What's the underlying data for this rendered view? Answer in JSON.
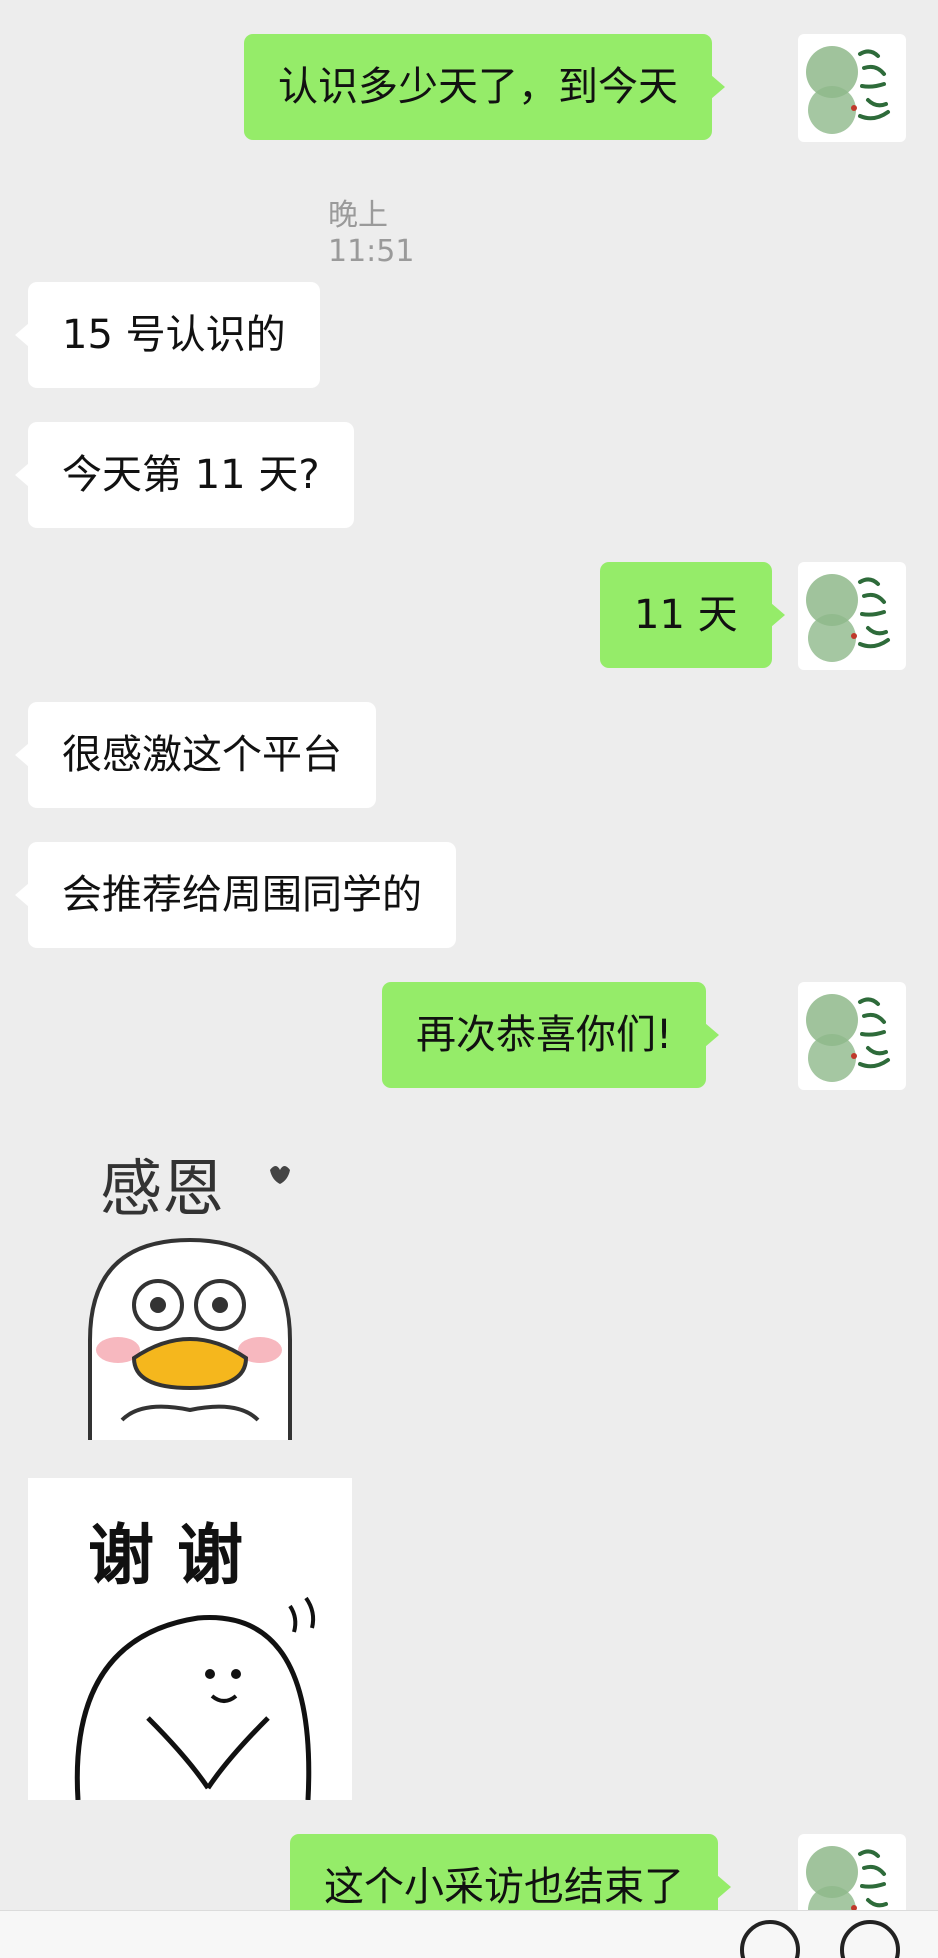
{
  "chat": {
    "timestamp": "晚上11:51",
    "messages": [
      {
        "id": 1,
        "side": "out",
        "text": "认识多少天了，到今天"
      },
      {
        "id": 2,
        "side": "in",
        "text": "15 号认识的"
      },
      {
        "id": 3,
        "side": "in",
        "text": "今天第 11 天?"
      },
      {
        "id": 4,
        "side": "out",
        "text": "11 天"
      },
      {
        "id": 5,
        "side": "in",
        "text": "很感激这个平台"
      },
      {
        "id": 6,
        "side": "in",
        "text": "会推荐给周围同学的"
      },
      {
        "id": 7,
        "side": "out",
        "text": "再次恭喜你们!"
      },
      {
        "id": 10,
        "side": "out",
        "text": "这个小采访也结束了"
      }
    ],
    "stickers": {
      "thanks_duck": {
        "text": "感恩"
      },
      "thanks_blob": {
        "text": "谢 谢"
      }
    },
    "colors": {
      "outgoing_bubble": "#95ec69",
      "incoming_bubble": "#ffffff",
      "background": "#ededed"
    }
  }
}
